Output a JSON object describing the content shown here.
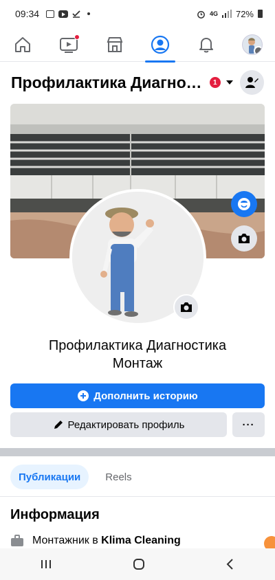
{
  "status_bar": {
    "time": "09:34",
    "network": "4G",
    "battery": "72%",
    "icons": [
      "gallery-icon",
      "youtube-icon",
      "check-icon",
      "dot-icon",
      "alarm-icon",
      "signal-icon",
      "battery-icon"
    ]
  },
  "top_nav": {
    "items": [
      {
        "name": "home",
        "icon": "home-icon",
        "active": false
      },
      {
        "name": "video",
        "icon": "video-icon",
        "active": false,
        "badge_dot": true
      },
      {
        "name": "marketplace",
        "icon": "store-icon",
        "active": false
      },
      {
        "name": "profile",
        "icon": "profile-icon",
        "active": true
      },
      {
        "name": "notifications",
        "icon": "bell-icon",
        "active": false
      },
      {
        "name": "menu",
        "icon": "avatar-menu-icon",
        "active": false
      }
    ]
  },
  "header": {
    "title": "Профилактика Диагностика Монтаж",
    "notification_count": "1"
  },
  "profile": {
    "name": "Профилактика Диагностика Монтаж"
  },
  "buttons": {
    "add_story": "Дополнить историю",
    "edit_profile": "Редактировать профиль",
    "more": "···"
  },
  "tabs": [
    {
      "label": "Публикации",
      "active": true
    },
    {
      "label": "Reels",
      "active": false
    }
  ],
  "info": {
    "title": "Информация",
    "job_prefix": "Монтажник в",
    "job_company": "Klima Cleaning"
  },
  "colors": {
    "accent": "#1877f2",
    "badge": "#e41e3f",
    "secondary_bg": "#e4e6eb",
    "separator": "#c9ccd1"
  }
}
